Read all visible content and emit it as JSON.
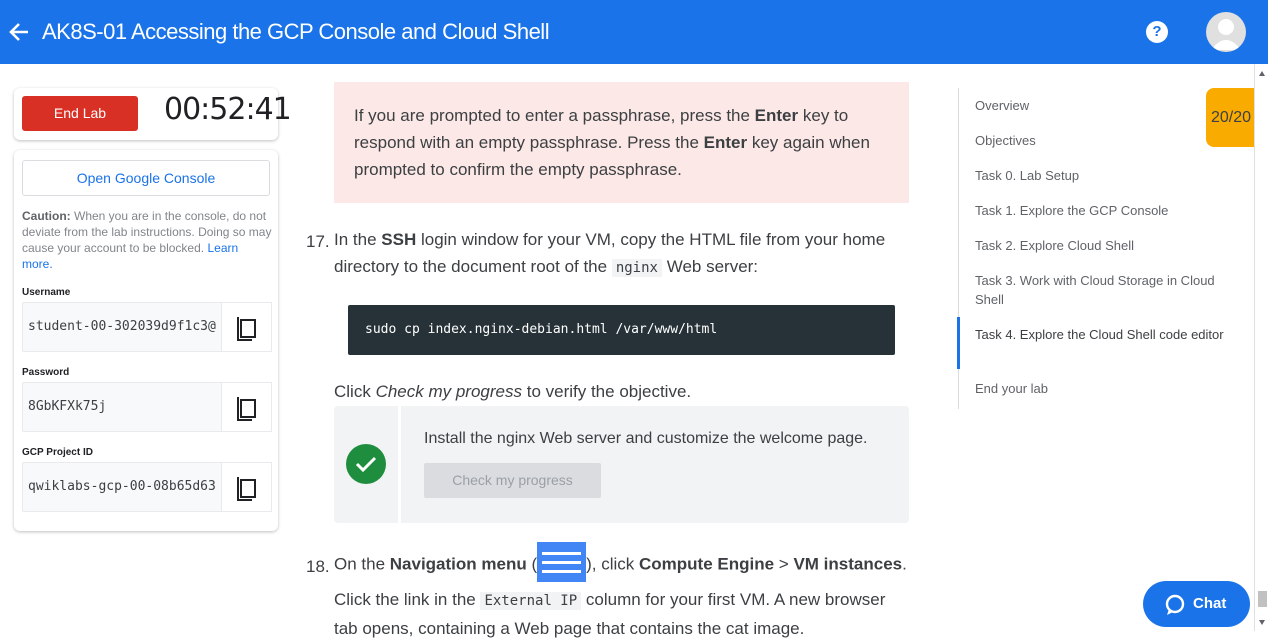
{
  "header": {
    "title": "AK8S-01 Accessing the GCP Console and Cloud Shell",
    "help_label": "?"
  },
  "lab_panel": {
    "end_lab_label": "End Lab",
    "timer": "00:52:41",
    "open_console_label": "Open Google Console",
    "caution_heading": "Caution:",
    "caution_text": " When you are in the console, do not deviate from the lab instructions. Doing so may cause your account to be blocked.",
    "learn_more": "Learn more.",
    "fields": [
      {
        "label": "Username",
        "value": "student-00-302039d9f1c3@"
      },
      {
        "label": "Password",
        "value": "8GbKFXk75j"
      },
      {
        "label": "GCP Project ID",
        "value": "qwiklabs-gcp-00-08b65d63"
      }
    ]
  },
  "content": {
    "note": {
      "t1": "If you are prompted to enter a passphrase, press the ",
      "b1": "Enter",
      "t2": " key to respond with an empty passphrase. Press the ",
      "b2": "Enter",
      "t3": " key again when prompted to confirm the empty passphrase."
    },
    "step17": {
      "number": "17.",
      "t1": "In the ",
      "b1": "SSH",
      "t2": " login window for your VM, copy the HTML file from your home directory to the document root of the ",
      "code": "nginx",
      "t3": " Web server:"
    },
    "code_block": "sudo cp index.nginx-debian.html /var/www/html",
    "check_line": {
      "t1": "Click ",
      "em": "Check my progress",
      "t2": " to verify the objective."
    },
    "progress": {
      "text": "Install the nginx Web server and customize the welcome page.",
      "button": "Check my progress"
    },
    "step18": {
      "number": "18.",
      "t1": "On the ",
      "b1": "Navigation menu",
      "t2": " (",
      "t3": "), click ",
      "b2": "Compute Engine",
      "t4": " > ",
      "b3": "VM instances",
      "t5": "."
    },
    "step18b": {
      "t1": "Click the link in the ",
      "code": "External IP",
      "t2": " column for your first VM. A new browser tab opens, containing a Web page that contains the cat image."
    }
  },
  "toc": {
    "items": [
      "Overview",
      "Objectives",
      "Task 0. Lab Setup",
      "Task 1. Explore the GCP Console",
      "Task 2. Explore Cloud Shell",
      "Task 3. Work with Cloud Storage in Cloud Shell",
      "Task 4. Explore the Cloud Shell code editor",
      "End your lab"
    ],
    "active_index": 6
  },
  "score": "20/20",
  "chat_label": "Chat",
  "colors": {
    "header_blue": "#1a73e8",
    "end_lab_red": "#d93025",
    "score_amber": "#f9ab00",
    "check_green": "#1e8e3e"
  }
}
